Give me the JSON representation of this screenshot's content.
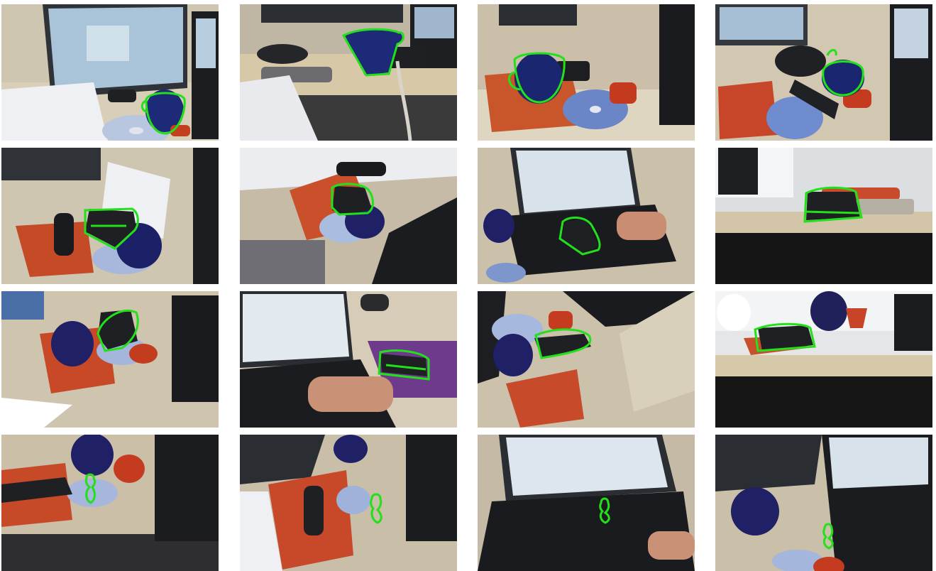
{
  "figure": {
    "rows": 4,
    "columns": 4,
    "outline_color": "#22e01a",
    "tracked_objects": [
      "mug",
      "stapler",
      "stapler",
      "figurine"
    ],
    "tiles": [
      {
        "row": 0,
        "col": 0,
        "object": "mug",
        "cable_hint": false
      },
      {
        "row": 0,
        "col": 1,
        "object": "mug",
        "cable_hint": true
      },
      {
        "row": 0,
        "col": 2,
        "object": "mug",
        "cable_hint": true
      },
      {
        "row": 0,
        "col": 3,
        "object": "mug",
        "cable_hint": true
      },
      {
        "row": 1,
        "col": 0,
        "object": "stapler",
        "cable_hint": true
      },
      {
        "row": 1,
        "col": 1,
        "object": "stapler",
        "cable_hint": true
      },
      {
        "row": 1,
        "col": 2,
        "object": "stapler",
        "cable_hint": false
      },
      {
        "row": 1,
        "col": 3,
        "object": "stapler",
        "cable_hint": false
      },
      {
        "row": 2,
        "col": 0,
        "object": "stapler",
        "cable_hint": true
      },
      {
        "row": 2,
        "col": 1,
        "object": "stapler",
        "cable_hint": false
      },
      {
        "row": 2,
        "col": 2,
        "object": "stapler",
        "cable_hint": true
      },
      {
        "row": 2,
        "col": 3,
        "object": "stapler",
        "cable_hint": true
      },
      {
        "row": 3,
        "col": 0,
        "object": "figurine",
        "cable_hint": true
      },
      {
        "row": 3,
        "col": 1,
        "object": "figurine",
        "cable_hint": true
      },
      {
        "row": 3,
        "col": 2,
        "object": "figurine",
        "cable_hint": false
      },
      {
        "row": 3,
        "col": 3,
        "object": "figurine",
        "cable_hint": true
      }
    ]
  }
}
